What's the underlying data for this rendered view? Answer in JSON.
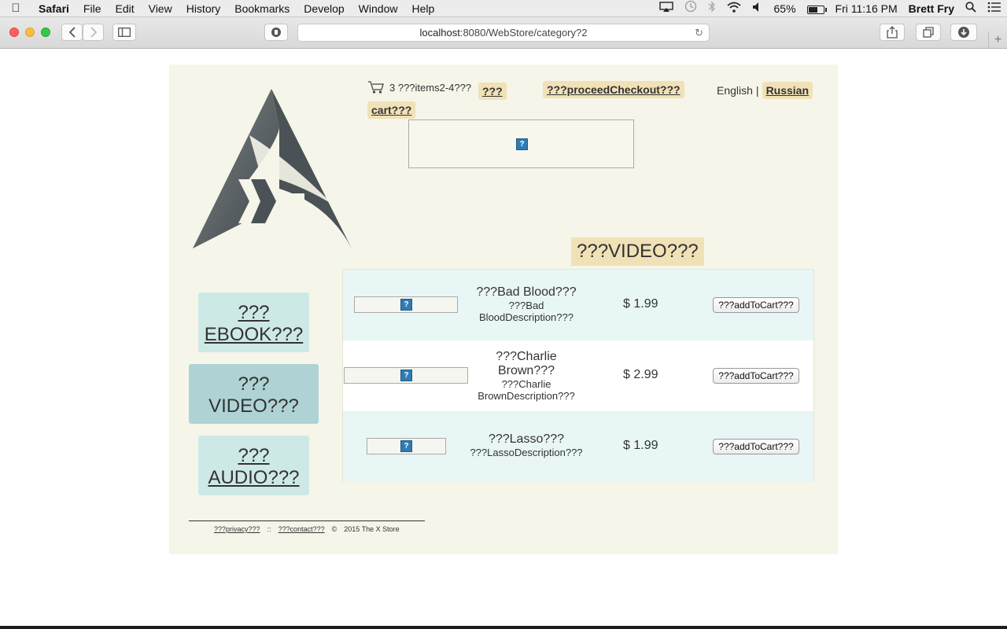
{
  "menubar": {
    "app_name": "Safari",
    "menus": [
      "File",
      "Edit",
      "View",
      "History",
      "Bookmarks",
      "Develop",
      "Window",
      "Help"
    ],
    "battery_percent": "65%",
    "battery_level": 0.65,
    "clock": "Fri 11:16 PM",
    "user": "Brett Fry"
  },
  "browser": {
    "url_host": "localhost",
    "url_rest": ":8080/WebStore/category?2"
  },
  "header": {
    "cart_summary": "3 ???items2-4???",
    "view_cart_part1": "???",
    "view_cart_part2": "cart???",
    "checkout_label": "???proceedCheckout???",
    "lang_english": "English",
    "lang_separator": "|",
    "lang_russian": "Russian"
  },
  "image_placeholder": "?",
  "category_title": "???VIDEO???",
  "sidebar": {
    "ebook": {
      "line1": "???",
      "line2": "EBOOK???"
    },
    "video": {
      "line1": "???",
      "line2": "VIDEO???"
    },
    "audio": {
      "line1": "???",
      "line2": "AUDIO???"
    }
  },
  "products": [
    {
      "name": "???Bad Blood???",
      "description_line1": "???Bad",
      "description_line2": "BloodDescription???",
      "price": "$ 1.99",
      "add_label": "???addToCart???"
    },
    {
      "name_line1": "???Charlie",
      "name_line2": "Brown???",
      "description_line1": "???Charlie",
      "description_line2": "BrownDescription???",
      "price": "$ 2.99",
      "add_label": "???addToCart???"
    },
    {
      "name": "???Lasso???",
      "description": "???LassoDescription???",
      "price": "$ 1.99",
      "add_label": "???addToCart???"
    }
  ],
  "footer": {
    "privacy": "???privacy???",
    "separator": "::",
    "contact": "???contact???",
    "copyright_symbol": "©",
    "copyright_text": "2015 The X Store"
  }
}
